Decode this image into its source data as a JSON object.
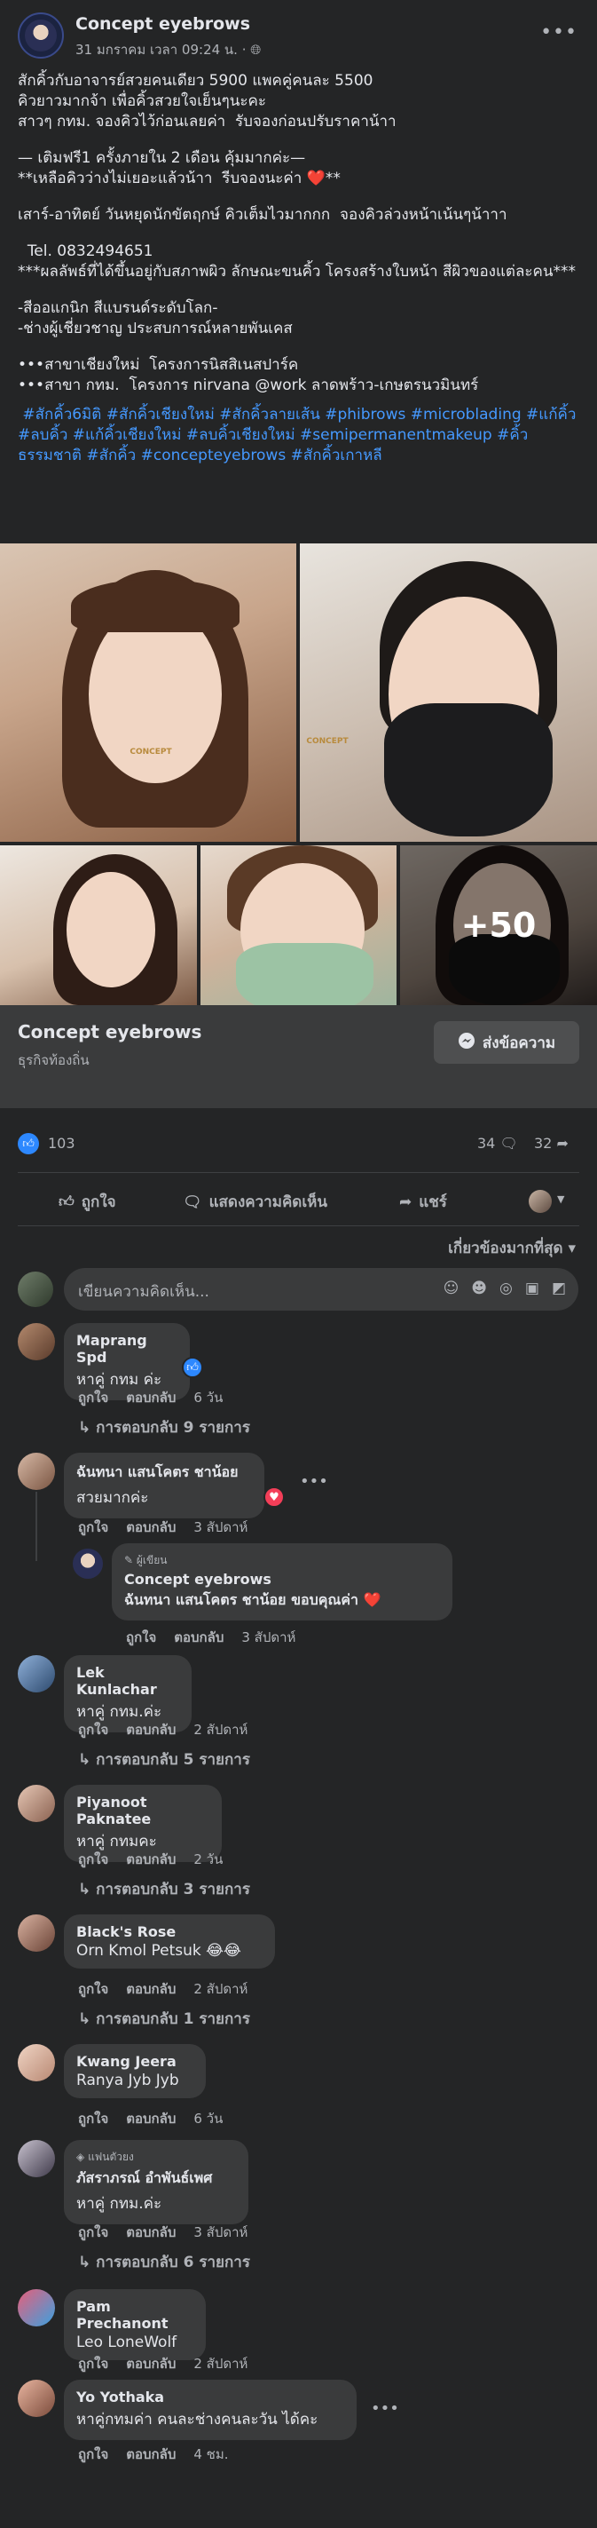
{
  "post": {
    "page_name": "Concept eyebrows",
    "meta": "31 มกราคม เวลา 09:24 น. · ",
    "globe_icon": "globe-icon",
    "more_label": "•••",
    "body": [
      "สักคิ้วกับอาจารย์สวยคนเดียว 5900 แพคคู่คนละ 5500",
      "คิวยาวมากจ้า เพื่อคิ้วสวยใจเย็นๆนะคะ",
      "สาวๆ กทม. จองคิวไว้ก่อนเลยค่า  รับจองก่อนปรับราคาน้าา",
      "",
      "— เติมฟรี1 ครั้งภายใน 2 เดือน คุ้มมากค่ะ—",
      "**เหลือคิวว่างไม่เยอะแล้วน้าา  รีบจองนะค่า ❤️**",
      "",
      "เสาร์-อาทิตย์ วันหยุดนักขัตฤกษ์ คิวเต็มไวมากกก  จองคิวล่วงหน้าเน้นๆน้าาา",
      "",
      "  Tel. 0832494651",
      "***ผลลัพธ์ที่ได้ขึ้นอยู่กับสภาพผิว ลักษณะขนคิ้ว โครงสร้างใบหน้า สีผิวของแต่ละคน***",
      "",
      "-สีออแกนิก สีแบรนด์ระดับโลก-",
      "-ช่างผู้เชี่ยวชาญ ประสบการณ์หลายพันเคส",
      "",
      "•••สาขาเชียงใหม่  โครงการนิสสิเนสปาร์ค",
      "•••สาขา กทม.  โครงการ nirvana @work ลาดพร้าว-เกษตรนวมินทร์"
    ],
    "hashtags": " #สักคิ้ว6มิติ #สักคิ้วเชียงใหม่ #สักคิ้วลายเส้น #phibrows #microblading #แก้คิ้ว #ลบคิ้ว #แก้คิ้วเชียงใหม่ #ลบคิ้วเชียงใหม่ #semipermanentmakeup #คิ้วธรรมชาติ #สักคิ้ว #concepteyebrows #สักคิ้วเกาหลี",
    "photo_more": "+50",
    "watermark": "CONCEPT"
  },
  "page_bar": {
    "name": "Concept eyebrows",
    "category": "ธุรกิจท้องถิ่น",
    "message_button": "ส่งข้อความ"
  },
  "stats": {
    "reactions": "103",
    "comments": "34",
    "shares": "32"
  },
  "actions": {
    "like": "ถูกใจ",
    "comment": "แสดงความคิดเห็น",
    "share": "แชร์"
  },
  "sort_label": "เกี่ยวข้องมากที่สุด",
  "write_placeholder": "เขียนความคิดเห็น...",
  "comments": [
    {
      "name": "Maprang Spd",
      "text": "หาคู่ กทม ค่ะ",
      "like": "ถูกใจ",
      "reply": "ตอบกลับ",
      "time": "6 วัน",
      "replies": "การตอบกลับ 9 รายการ",
      "reaction": "like"
    },
    {
      "name": "ฉันทนา แสนโคตร ชาน้อย",
      "text": "สวยมากค่ะ",
      "like": "ถูกใจ",
      "reply": "ตอบกลับ",
      "time": "3 สัปดาห์",
      "reaction": "love",
      "nested": {
        "badge": "ผู้เขียน",
        "name": "Concept eyebrows",
        "text": "ฉันทนา แสนโคตร ชาน้อย ขอบคุณค่า ❤️",
        "like": "ถูกใจ",
        "reply": "ตอบกลับ",
        "time": "3 สัปดาห์"
      }
    },
    {
      "name": "Lek Kunlachar",
      "text": "หาคู่ กทม.ค่ะ",
      "like": "ถูกใจ",
      "reply": "ตอบกลับ",
      "time": "2 สัปดาห์",
      "replies": "การตอบกลับ 5 รายการ"
    },
    {
      "name": "Piyanoot Paknatee",
      "text": "หาคู่ กทมคะ",
      "like": "ถูกใจ",
      "reply": "ตอบกลับ",
      "time": "2 วัน",
      "replies": "การตอบกลับ 3 รายการ"
    },
    {
      "name": "Black's Rose",
      "text": "Orn Kmol Petsuk 😂😂",
      "like": "ถูกใจ",
      "reply": "ตอบกลับ",
      "time": "2 สัปดาห์",
      "replies": "การตอบกลับ 1 รายการ"
    },
    {
      "name": "Kwang Jeera",
      "text": "Ranya Jyb Jyb",
      "like": "ถูกใจ",
      "reply": "ตอบกลับ",
      "time": "6 วัน"
    },
    {
      "badge": "แฟนตัวยง",
      "name": "ภัสราภรณ์ อำพันธ์เพศ",
      "text": "หาคู่ กทม.ค่ะ",
      "like": "ถูกใจ",
      "reply": "ตอบกลับ",
      "time": "3 สัปดาห์",
      "replies": "การตอบกลับ 6 รายการ"
    },
    {
      "name": "Pam Prechanont",
      "text": "Leo LoneWolf",
      "like": "ถูกใจ",
      "reply": "ตอบกลับ",
      "time": "2 สัปดาห์"
    },
    {
      "name": "Yo Yothaka",
      "text": "หาคู่กทมค่า คนละช่างคนละวัน ได้คะ",
      "like": "ถูกใจ",
      "reply": "ตอบกลับ",
      "time": "4 ชม."
    }
  ],
  "colors": {
    "background": "#242526",
    "surface": "#3a3b3c",
    "link": "#4599ff",
    "like_blue": "#2d88ff",
    "love_red": "#f33e58"
  }
}
